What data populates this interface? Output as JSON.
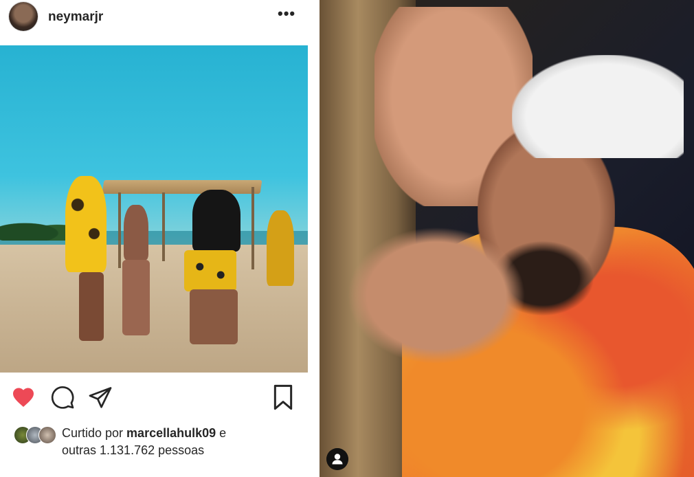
{
  "post": {
    "username": "neymarjr",
    "more_label": "•••",
    "likes": {
      "prefix": "Curtido por ",
      "liker": "marcellahulk09",
      "connector": " e",
      "others": "outras 1.131.762 pessoas"
    }
  },
  "colors": {
    "heart": "#ed4956",
    "text": "#262626"
  },
  "icons": [
    "heart-icon",
    "comment-icon",
    "share-icon",
    "save-icon",
    "user-tag-icon"
  ]
}
